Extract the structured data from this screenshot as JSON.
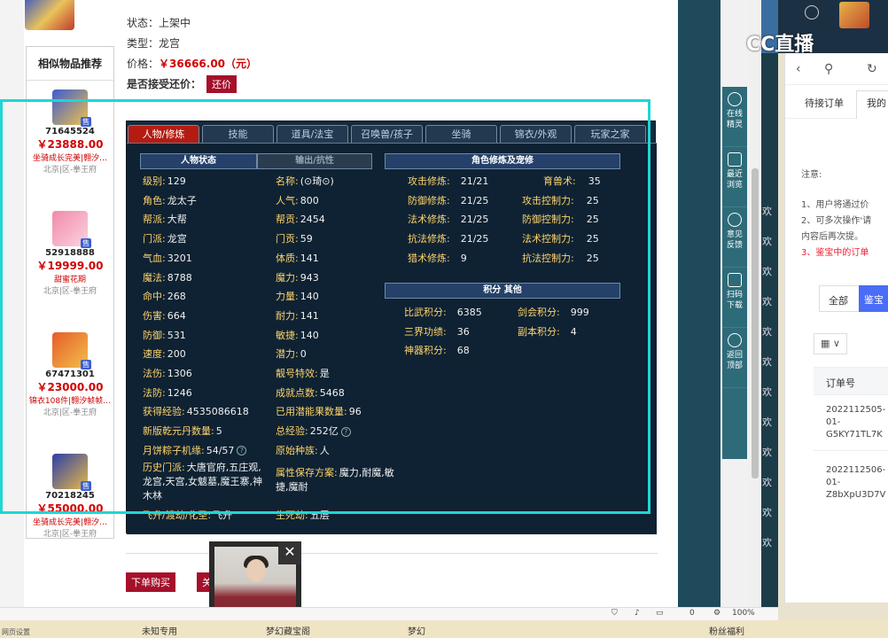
{
  "item_info": {
    "status_label": "状态：",
    "status_value": "上架中",
    "type_label": "类型：",
    "type_value": "龙宫",
    "price_label": "价格：",
    "price_value": "￥36666.00（元）",
    "bargain_label": "是否接受还价：",
    "bargain_button": "还价"
  },
  "similar": {
    "title": "相似物品推荐",
    "items": [
      {
        "id": "71645524",
        "price": "￥23888.00",
        "desc": "坐骑成长完美|翱汐…",
        "server": "北京|区-拳王府",
        "tag": "售"
      },
      {
        "id": "52918888",
        "price": "￥19999.00",
        "desc": "甜蜜花期",
        "server": "北京|区-拳王府",
        "tag": "售"
      },
      {
        "id": "67471301",
        "price": "￥23000.00",
        "desc": "锦衣108件|翱汐帧帧…",
        "server": "北京|区-拳王府",
        "tag": "售"
      },
      {
        "id": "70218245",
        "price": "￥55000.00",
        "desc": "坐骑成长完美|翱汐…",
        "server": "北京|区-拳王府",
        "tag": "售"
      }
    ]
  },
  "tabs": [
    "人物/修炼",
    "技能",
    "道具/法宝",
    "召唤兽/孩子",
    "坐骑",
    "锦衣/外观",
    "玩家之家"
  ],
  "sections": {
    "char_state": "人物状态",
    "output_resist": "输出/抗性",
    "cultivation": "角色修炼及宠修",
    "points": "积分 其他"
  },
  "stats_left": [
    {
      "k": "级别:",
      "v": "129"
    },
    {
      "k": "角色:",
      "v": "龙太子"
    },
    {
      "k": "帮派:",
      "v": "大帮"
    },
    {
      "k": "门派:",
      "v": "龙宫"
    },
    {
      "k": "气血:",
      "v": "3201"
    },
    {
      "k": "魔法:",
      "v": "8788"
    },
    {
      "k": "命中:",
      "v": "268"
    },
    {
      "k": "伤害:",
      "v": "664"
    },
    {
      "k": "防御:",
      "v": "531"
    },
    {
      "k": "速度:",
      "v": "200"
    },
    {
      "k": "法伤:",
      "v": "1306"
    },
    {
      "k": "法防:",
      "v": "1246"
    }
  ],
  "stats_right": [
    {
      "k": "名称:",
      "v": "(⊙琦⊙)"
    },
    {
      "k": "人气:",
      "v": "800"
    },
    {
      "k": "帮贡:",
      "v": "2454"
    },
    {
      "k": "门贡:",
      "v": "59"
    },
    {
      "k": "体质:",
      "v": "141"
    },
    {
      "k": "魔力:",
      "v": "943"
    },
    {
      "k": "力量:",
      "v": "140"
    },
    {
      "k": "耐力:",
      "v": "141"
    },
    {
      "k": "敏捷:",
      "v": "140"
    },
    {
      "k": "潜力:",
      "v": "0"
    },
    {
      "k": "靓号特效:",
      "v": "是"
    },
    {
      "k": "成就点数:",
      "v": "5468"
    }
  ],
  "extra": {
    "exp_k": "获得经验:",
    "exp_v": "4535086618",
    "potential_k": "已用潜能果数量:",
    "potential_v": "96",
    "qiankun_k": "新版乾元丹数量:",
    "qiankun_v": "5",
    "total_exp_k": "总经验:",
    "total_exp_v": "252亿",
    "mooncake_k": "月饼粽子机缘:",
    "mooncake_v": "54/57",
    "origin_k": "原始种族:",
    "origin_v": "人",
    "history_k": "历史门派:",
    "history_v": "大唐官府,五庄观,龙宫,天宫,女魃墓,魔王寨,神木林",
    "attr_k": "属性保存方案:",
    "attr_v": "魔力,耐魔,敏捷,魔耐",
    "fly_k": "飞升/渡劫/化圣:",
    "fly_v": "飞升",
    "reborn_k": "生死劫:",
    "reborn_v": "五层"
  },
  "cultivation": [
    {
      "k": "攻击修炼:",
      "v": "21/21",
      "k2": "育兽术:",
      "v2": "35"
    },
    {
      "k": "防御修炼:",
      "v": "21/25",
      "k2": "攻击控制力:",
      "v2": "25"
    },
    {
      "k": "法术修炼:",
      "v": "21/25",
      "k2": "防御控制力:",
      "v2": "25"
    },
    {
      "k": "抗法修炼:",
      "v": "21/25",
      "k2": "法术控制力:",
      "v2": "25"
    },
    {
      "k": "猎术修炼:",
      "v": "9",
      "k2": "抗法控制力:",
      "v2": "25"
    }
  ],
  "points": [
    {
      "k": "比武积分:",
      "v": "6385",
      "k2": "剑会积分:",
      "v2": "999"
    },
    {
      "k": "三界功绩:",
      "v": "36",
      "k2": "副本积分:",
      "v2": "4"
    },
    {
      "k": "神器积分:",
      "v": "68",
      "k2": "",
      "v2": ""
    }
  ],
  "actions": {
    "buy": "下单购买",
    "buy2": "关"
  },
  "rail": [
    {
      "label": "在线\n精灵"
    },
    {
      "label": "最近\n浏览"
    },
    {
      "label": "意见\n反馈"
    },
    {
      "label": "扫码\n下载"
    },
    {
      "label": "返回\n顶部"
    }
  ],
  "right_panel": {
    "tab1": "待接订单",
    "tab2": "我的",
    "notice_title": "注意:",
    "notice1": "1、用户将通过价",
    "notice2": "2、可多次操作'请",
    "notice3": "内容后再次提。",
    "notice4": "3、鉴宝中的订单",
    "filter_all": "全部",
    "filter_sel": "鉴宝",
    "grid": "▦ ∨",
    "order_head": "订单号",
    "order1_a": "2022112505-",
    "order1_b": "01-",
    "order1_c": "G5KY71TL7K",
    "order2_a": "2022112506-",
    "order2_b": "01-",
    "order2_c": "Z8bXpU3D7V"
  },
  "cc_logo": "CC直播",
  "status_bar": {
    "zoom": "100%",
    "count": "0"
  },
  "bottom_bar": [
    "未知专用",
    "梦幻藏宝阁",
    "梦幻",
    "粉丝福利"
  ],
  "bg_texts": [
    "欢",
    "欢",
    "欢",
    "欢",
    "欢",
    "欢",
    "欢",
    "欢",
    "欢",
    "欢",
    "欢",
    "欢"
  ],
  "left_bottom": "网页设置"
}
